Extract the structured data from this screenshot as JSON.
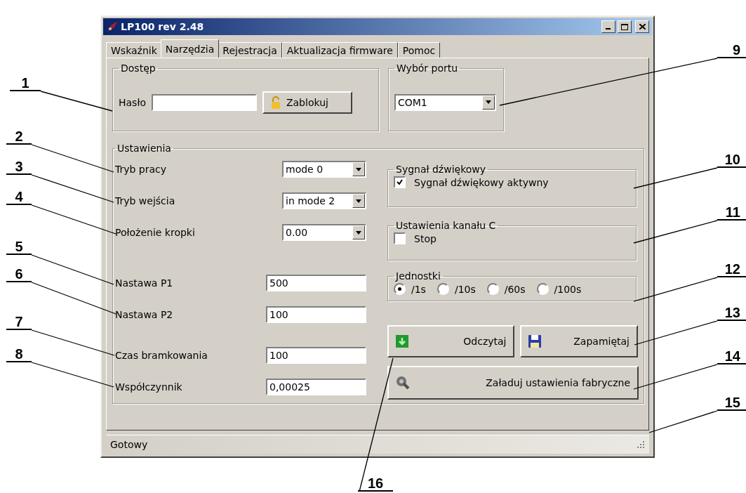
{
  "window": {
    "title": "LP100 rev 2.48"
  },
  "tabs": [
    {
      "label": "Wskaźnik",
      "selected": false
    },
    {
      "label": "Narzędzia",
      "selected": true
    },
    {
      "label": "Rejestracja",
      "selected": false
    },
    {
      "label": "Aktualizacja firmware",
      "selected": false
    },
    {
      "label": "Pomoc",
      "selected": false
    }
  ],
  "access_group": {
    "title": "Dostęp",
    "password_label": "Hasło",
    "lock_button": "Zablokuj"
  },
  "port_group": {
    "title": "Wybór portu",
    "port": "COM1"
  },
  "settings_group": {
    "title": "Ustawienia",
    "field_groups": [
      [
        {
          "kind": "combo",
          "label": "Tryb pracy",
          "value": "mode 0"
        },
        {
          "kind": "combo",
          "label": "Tryb wejścia",
          "value": "in mode 2"
        },
        {
          "kind": "combo",
          "label": "Położenie kropki",
          "value": "0.00"
        }
      ],
      [
        {
          "kind": "text",
          "label": "Nastawa P1",
          "value": "500"
        },
        {
          "kind": "text",
          "label": "Nastawa P2",
          "value": "100"
        }
      ],
      [
        {
          "kind": "text",
          "label": "Czas bramkowania",
          "value": "100"
        },
        {
          "kind": "text",
          "label": "Współczynnik",
          "value": "0,00025"
        }
      ]
    ]
  },
  "beep_group": {
    "title": "Sygnał dźwiękowy",
    "checkbox": {
      "label": "Sygnał dźwiękowy aktywny",
      "checked": true
    }
  },
  "channel_c_group": {
    "title": "Ustawienia kanału C",
    "checkbox": {
      "label": "Stop",
      "checked": false
    }
  },
  "units_group": {
    "title": "Jednostki",
    "options": [
      {
        "label": "/1s",
        "selected": true
      },
      {
        "label": "/10s",
        "selected": false
      },
      {
        "label": "/60s",
        "selected": false
      },
      {
        "label": "/100s",
        "selected": false
      }
    ]
  },
  "buttons": [
    {
      "kind": "read",
      "label": "Odczytaj"
    },
    {
      "kind": "save",
      "label": "Zapamiętaj"
    },
    {
      "kind": "factory",
      "label": "Załaduj ustawienia fabryczne"
    }
  ],
  "status_bar": {
    "text": "Gotowy"
  },
  "callouts": [
    "1",
    "2",
    "3",
    "4",
    "5",
    "6",
    "7",
    "8",
    "9",
    "10",
    "11",
    "12",
    "13",
    "14",
    "15",
    "16"
  ]
}
